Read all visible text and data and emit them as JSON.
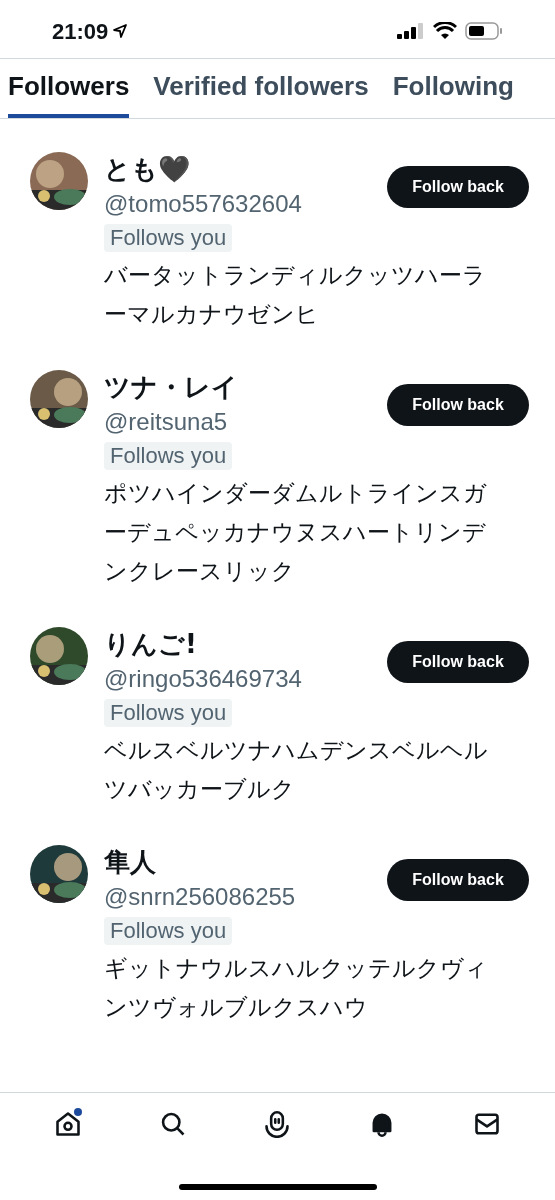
{
  "status_bar": {
    "time": "21:09"
  },
  "tabs": [
    {
      "label": "Followers",
      "selected": true
    },
    {
      "label": "Verified followers",
      "selected": false
    },
    {
      "label": "Following",
      "selected": false
    }
  ],
  "users": [
    {
      "name": "とも🖤",
      "handle": "@tomo557632604",
      "badge": "Follows you",
      "bio": "バータットランディルクッツハーラーマルカナウゼンヒ",
      "button": "Follow back"
    },
    {
      "name": "ツナ・レイ",
      "handle": "@reitsuna5",
      "badge": "Follows you",
      "bio": "ポツハインダーダムルトラインスガーデュペッカナウヌスハートリンデンクレースリック",
      "button": "Follow back"
    },
    {
      "name": "りんご!",
      "handle": "@ringo536469734",
      "badge": "Follows you",
      "bio": "ベルスベルツナハムデンスベルヘルツバッカーブルク",
      "button": "Follow back"
    },
    {
      "name": "隼人",
      "handle": "@snrn256086255",
      "badge": "Follows you",
      "bio": "ギットナウルスハルクッテルクヴィンツヴォルブルクスハウ",
      "button": "Follow back"
    }
  ],
  "nav": [
    {
      "kind": "home",
      "selected": false,
      "dot": true
    },
    {
      "kind": "search",
      "selected": false,
      "dot": false
    },
    {
      "kind": "spaces",
      "selected": false,
      "dot": false
    },
    {
      "kind": "notifications",
      "selected": true,
      "dot": false
    },
    {
      "kind": "messages",
      "selected": false,
      "dot": false
    }
  ]
}
